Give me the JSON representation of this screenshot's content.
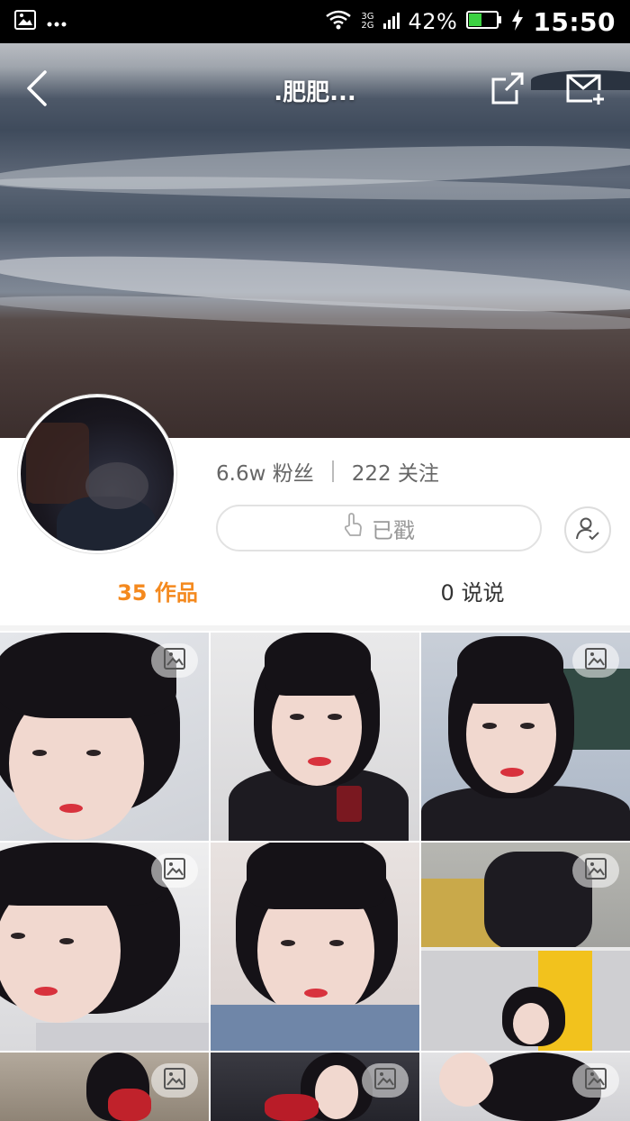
{
  "status_bar": {
    "network_top": "3G",
    "network_bottom": "2G",
    "battery": "42%",
    "time": "15:50"
  },
  "header": {
    "title": ".肥肥..."
  },
  "profile": {
    "stats_fans": "6.6w 粉丝",
    "stats_follow": "222 关注",
    "followed_label": "已戳"
  },
  "tabs": [
    {
      "label": "35 作品"
    },
    {
      "label": "0 说说"
    }
  ],
  "colors": {
    "accent": "#f4891e"
  },
  "icons": {
    "back": "back-arrow-icon",
    "share": "share-icon",
    "mail": "add-mail-icon",
    "badge": "photo-icon"
  }
}
